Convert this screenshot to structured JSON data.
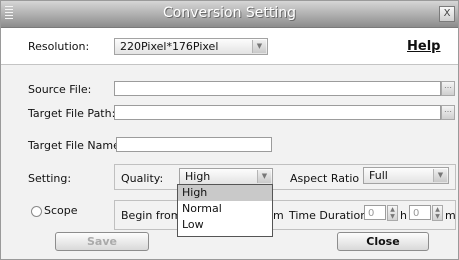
{
  "window": {
    "title": "Conversion Setting",
    "close_glyph": "X"
  },
  "resolution": {
    "label": "Resolution:",
    "value": "220Pixel*176Pixel"
  },
  "help_link": "Help",
  "files": {
    "source_label": "Source File:",
    "target_path_label": "Target File Path:",
    "target_name_label": "Target File Name:"
  },
  "setting": {
    "label": "Setting:",
    "quality_label": "Quality:",
    "quality_value": "High",
    "quality_options": [
      "High",
      "Normal",
      "Low"
    ],
    "aspect_label": "Aspect Ratio :",
    "aspect_value": "Full"
  },
  "scope": {
    "label": "Scope",
    "begin_label": "Begin from:",
    "begin_unit": "m",
    "duration_label": "Time Duration:",
    "hours_value": "0",
    "hours_unit": "h",
    "minutes_value": "0",
    "minutes_unit": "m"
  },
  "buttons": {
    "save": "Save",
    "close": "Close"
  },
  "colors": {
    "titlebar_top": "#d6d6d6",
    "titlebar_bottom": "#8c8c8c",
    "selection": "#c9c9c9"
  }
}
